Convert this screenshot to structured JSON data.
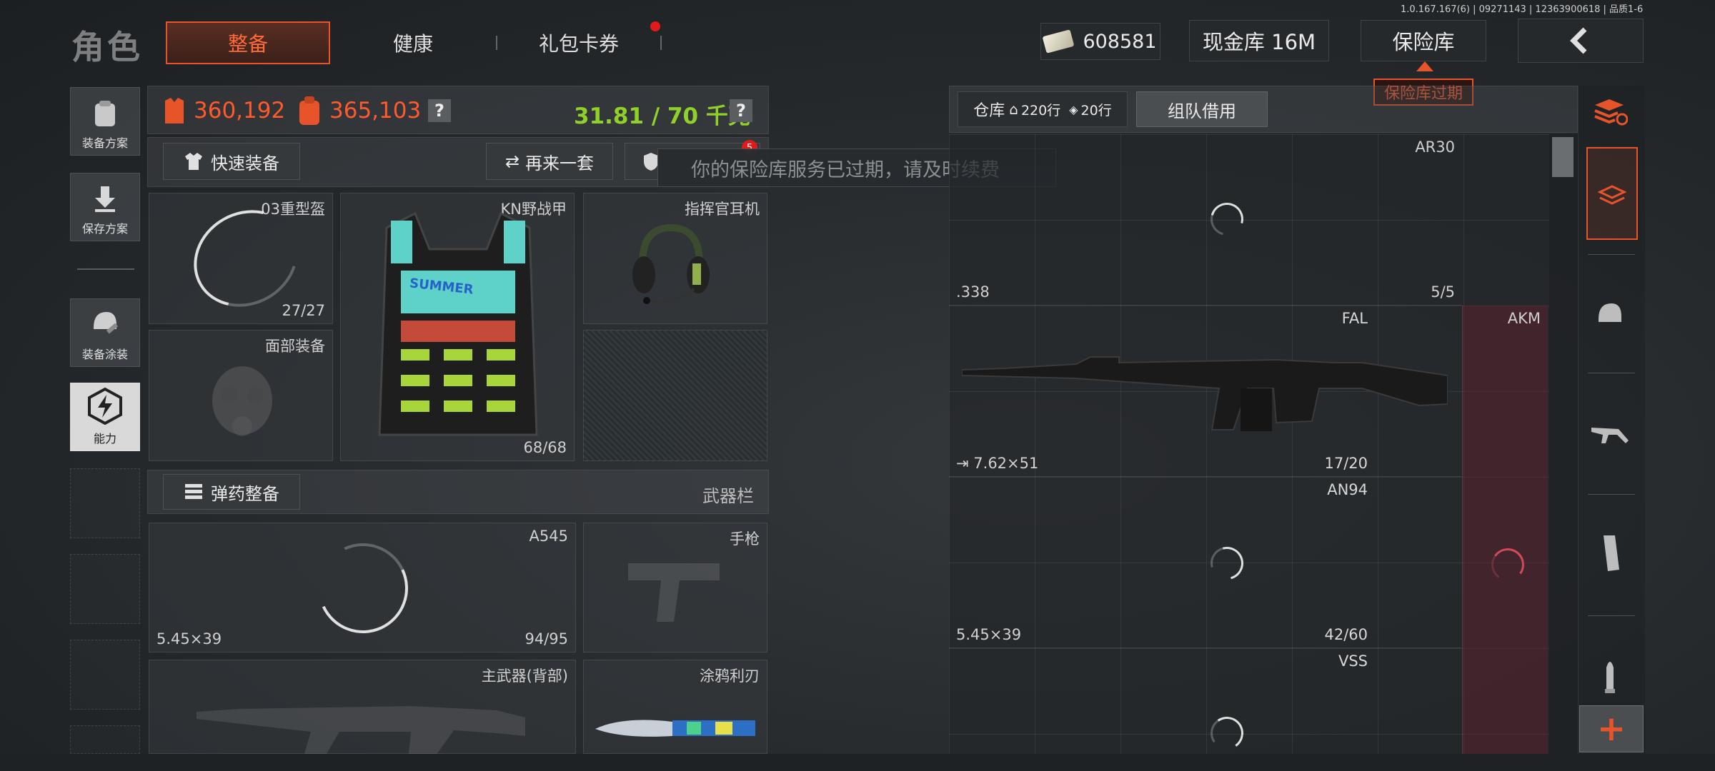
{
  "version": "1.0.167.167(6) | 09271143 | 12363900618 | 品质1-6",
  "header": {
    "title": "角色",
    "tabs": [
      "整备",
      "健康",
      "礼包卡券"
    ],
    "currency": "608581",
    "cash_vault": "现金库 16M",
    "vault": "保险库",
    "vault_expired": "保险库过期",
    "back_arrow": "‹"
  },
  "left_rail": {
    "items": [
      "装备方案",
      "保存方案",
      "装备涂装",
      "能力"
    ]
  },
  "stats": {
    "value1": "360,192",
    "value2": "365,103",
    "weight": "31.81 / 70 千克",
    "help": "?"
  },
  "gear": {
    "quick_equip": "快速装备",
    "again": "再来一套",
    "badge": "5",
    "tooltip": "你的保险库服务已过期，请及时续费",
    "helmet": {
      "name": "03重型盔",
      "count": "27/27"
    },
    "armor": {
      "name": "KN野战甲",
      "count": "68/68",
      "patch": "SUMMER"
    },
    "headset": {
      "name": "指挥官耳机"
    },
    "face": {
      "name": "面部装备"
    }
  },
  "weapons": {
    "ammo_button": "弹药整备",
    "weapon_bar": "武器栏",
    "a545": {
      "name": "A545",
      "ammo": "5.45×39",
      "count": "94/95"
    },
    "pistol": {
      "name": "手枪"
    },
    "primary": {
      "name": "主武器(背部)"
    },
    "knife": {
      "name": "涂鸦利刃"
    }
  },
  "storage": {
    "warehouse": "仓库",
    "rows1": "220行",
    "rows2": "20行",
    "team_borrow": "组队借用",
    "items": [
      {
        "name": "AR30",
        "ammo": ".338",
        "count": "5/5"
      },
      {
        "name": "FAL",
        "ammo": "7.62×51",
        "count": "17/20"
      },
      {
        "name": "AKM"
      },
      {
        "name": "AN94",
        "ammo": "5.45×39",
        "count": "42/60"
      },
      {
        "name": "VSS"
      }
    ]
  },
  "right_rail": {
    "add": "+"
  },
  "colors": {
    "accent_orange": "#e8542a",
    "weight_green": "#8fd12a",
    "highlight_red": "#5a1f28"
  }
}
